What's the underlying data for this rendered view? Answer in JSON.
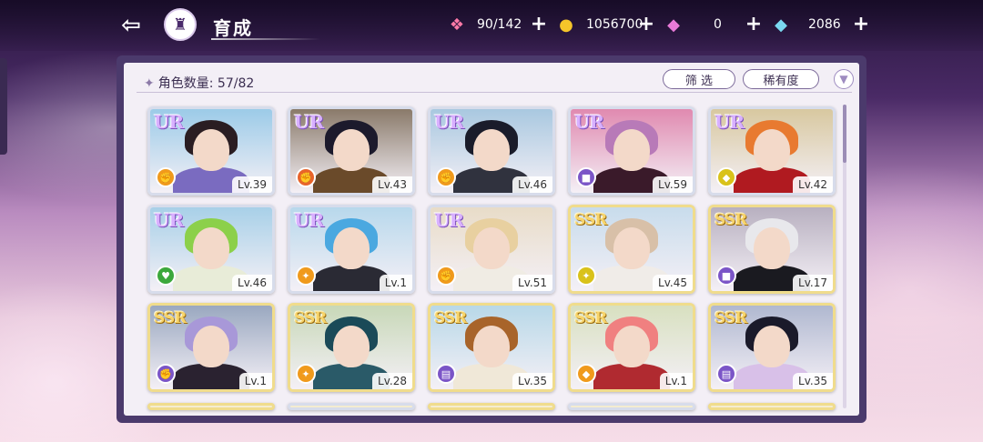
{
  "header": {
    "title": "育成",
    "back_icon": "back-arrow-icon",
    "home_icon": "castle-home-icon"
  },
  "resources": [
    {
      "name": "stamina",
      "icon": "candy-icon",
      "value": "90/142"
    },
    {
      "name": "gold",
      "icon": "gold-coin-icon",
      "value": "1056700"
    },
    {
      "name": "pink-gem",
      "icon": "pink-diamond-icon",
      "value": "0"
    },
    {
      "name": "blue-gem",
      "icon": "blue-diamond-icon",
      "value": "2086"
    }
  ],
  "panel": {
    "count_label": "角色数量:",
    "count_value": "57/82",
    "filter_label": "筛 选",
    "rarity_label": "稀有度",
    "sort_icon": "chevron-down-icon"
  },
  "cards": [
    {
      "rarity": "UR",
      "level": "Lv.39",
      "type_color": "#f09a1c",
      "type_icon": "fist-icon",
      "hair": "#2a1d22",
      "body": "#7a6bc0",
      "bg": "#9ccbe8"
    },
    {
      "rarity": "UR",
      "level": "Lv.43",
      "type_color": "#e8642a",
      "type_icon": "fist-icon",
      "hair": "#1c1a2c",
      "body": "#6a4a2a",
      "bg": "#8a7a6a"
    },
    {
      "rarity": "UR",
      "level": "Lv.46",
      "type_color": "#f09a1c",
      "type_icon": "fist-icon",
      "hair": "#1a1c2a",
      "body": "#30323e",
      "bg": "#a9c8e0"
    },
    {
      "rarity": "UR",
      "level": "Lv.59",
      "type_color": "#7b55c7",
      "type_icon": "boot-icon",
      "hair": "#b87ab8",
      "body": "#3a1a2a",
      "bg": "#e08ab0"
    },
    {
      "rarity": "UR",
      "level": "Lv.42",
      "type_color": "#d9c21a",
      "type_icon": "shield-icon",
      "hair": "#e87a30",
      "body": "#b01a20",
      "bg": "#d8c8a0"
    },
    {
      "rarity": "UR",
      "level": "Lv.46",
      "type_color": "#3ca83c",
      "type_icon": "heart-hand-icon",
      "hair": "#8cd04a",
      "body": "#e8ecd8",
      "bg": "#a8d0e8"
    },
    {
      "rarity": "UR",
      "level": "Lv.1",
      "type_color": "#f09a1c",
      "type_icon": "wand-icon",
      "hair": "#4aa8e0",
      "body": "#2a2a34",
      "bg": "#b8d8ec"
    },
    {
      "rarity": "UR",
      "level": "Lv.51",
      "type_color": "#f09a1c",
      "type_icon": "fist-icon",
      "hair": "#e8d0a0",
      "body": "#f0ece4",
      "bg": "#e8dcc8"
    },
    {
      "rarity": "SSR",
      "level": "Lv.45",
      "type_color": "#d9c21a",
      "type_icon": "wand-icon",
      "hair": "#d8c0a8",
      "body": "#f0ece8",
      "bg": "#c8dcec"
    },
    {
      "rarity": "SSR",
      "level": "Lv.17",
      "type_color": "#7b55c7",
      "type_icon": "boot-icon",
      "hair": "#e8e8ec",
      "body": "#1a1a20",
      "bg": "#b8b0c0"
    },
    {
      "rarity": "SSR",
      "level": "Lv.1",
      "type_color": "#7b55c7",
      "type_icon": "fist-icon",
      "hair": "#a898d8",
      "body": "#2a2230",
      "bg": "#9aa8c0"
    },
    {
      "rarity": "SSR",
      "level": "Lv.28",
      "type_color": "#f09a1c",
      "type_icon": "wand-icon",
      "hair": "#1a4a58",
      "body": "#2a5a68",
      "bg": "#c8d8b8"
    },
    {
      "rarity": "SSR",
      "level": "Lv.35",
      "type_color": "#7b55c7",
      "type_icon": "book-icon",
      "hair": "#a8642a",
      "body": "#f0e8d8",
      "bg": "#b8d8e8"
    },
    {
      "rarity": "SSR",
      "level": "Lv.1",
      "type_color": "#f09a1c",
      "type_icon": "shield-icon",
      "hair": "#f08080",
      "body": "#b02a30",
      "bg": "#d8e0c0"
    },
    {
      "rarity": "SSR",
      "level": "Lv.35",
      "type_color": "#7b55c7",
      "type_icon": "book-icon",
      "hair": "#1a1a2a",
      "body": "#d8c0e8",
      "bg": "#b0b8d0"
    }
  ]
}
